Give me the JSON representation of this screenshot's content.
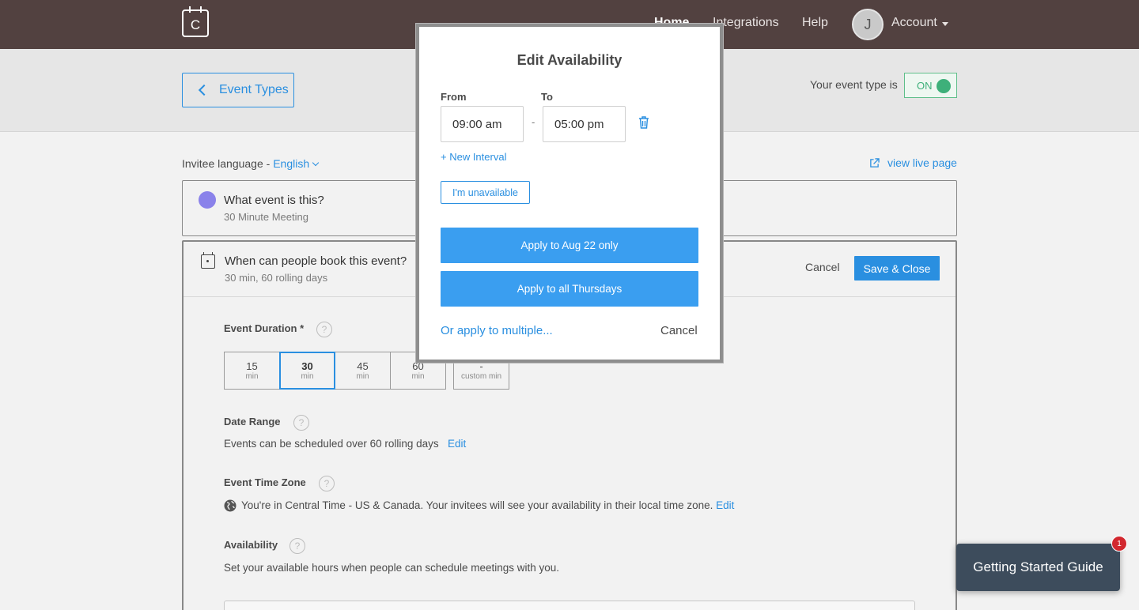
{
  "nav": {
    "logo_letter": "C",
    "home": "Home",
    "integrations": "Integrations",
    "help": "Help",
    "avatar_letter": "J",
    "account": "Account"
  },
  "header": {
    "back_label": "Event Types",
    "status_label": "Your event type is",
    "toggle_label": "ON"
  },
  "language": {
    "prefix": "Invitee language - ",
    "value": "English"
  },
  "live_link": "view live page",
  "event_card": {
    "title": "What event is this?",
    "subtitle": "30 Minute Meeting",
    "color": "#8a82ea"
  },
  "booking_card": {
    "title": "When can people book this event?",
    "subtitle": "30 min, 60 rolling days",
    "cancel": "Cancel",
    "save": "Save & Close"
  },
  "duration": {
    "title": "Event Duration *",
    "options": [
      {
        "value": "15",
        "unit": "min"
      },
      {
        "value": "30",
        "unit": "min",
        "selected": true
      },
      {
        "value": "45",
        "unit": "min"
      },
      {
        "value": "60",
        "unit": "min"
      }
    ],
    "custom": {
      "value": "-",
      "unit": "custom min"
    }
  },
  "date_range": {
    "title": "Date Range",
    "text": "Events can be scheduled over 60 rolling days",
    "edit": "Edit"
  },
  "time_zone": {
    "title": "Event Time Zone",
    "text": "You're in Central Time - US & Canada. Your invitees will see your availability in their local time zone.",
    "edit": "Edit"
  },
  "availability": {
    "title": "Availability",
    "text": "Set your available hours when people can schedule meetings with you."
  },
  "modal": {
    "title": "Edit Availability",
    "from_label": "From",
    "to_label": "To",
    "from_value": "09:00 am",
    "to_value": "05:00 pm",
    "dash": "-",
    "new_interval": "+ New Interval",
    "unavailable": "I'm unavailable",
    "apply_date": "Apply to Aug 22 only",
    "apply_weekday": "Apply to all Thursdays",
    "apply_multiple": "Or apply to multiple...",
    "cancel": "Cancel"
  },
  "guide": {
    "label": "Getting Started Guide",
    "badge": "1"
  },
  "colors": {
    "accent": "#2a8fe0",
    "nav_bg": "#524140",
    "toggle_on": "#3eb07a",
    "badge": "#d2282f"
  }
}
